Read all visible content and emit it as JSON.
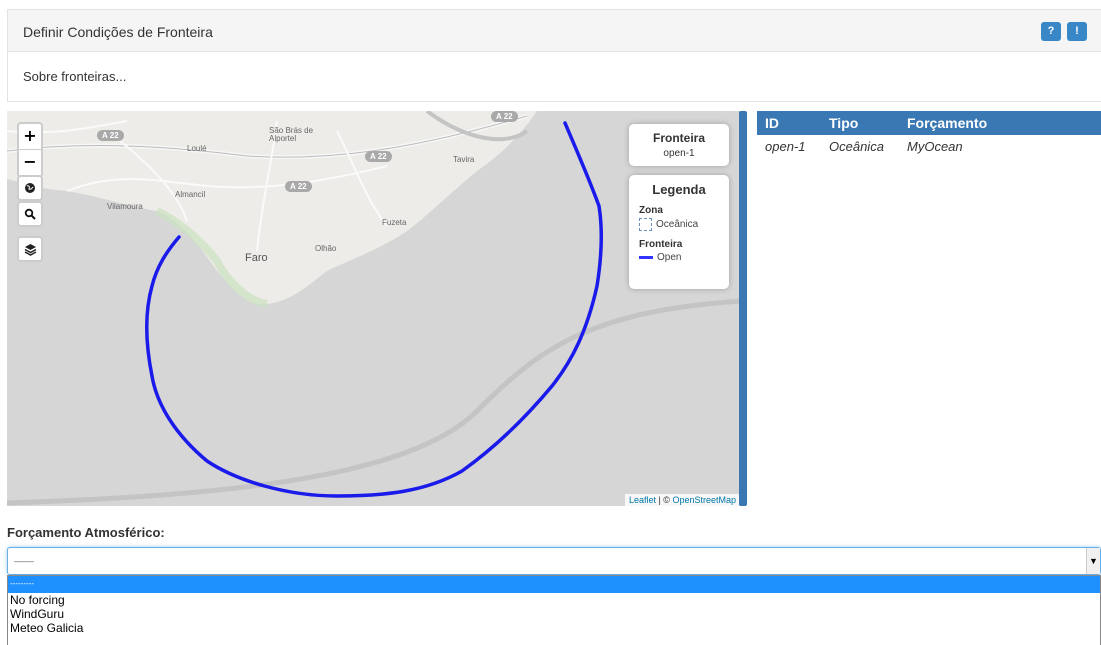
{
  "panel": {
    "title": "Definir Condições de Fronteira",
    "body": "Sobre fronteiras...",
    "help_icon": "question-icon",
    "info_icon": "info-icon",
    "help_label": "?",
    "info_label": "!"
  },
  "map": {
    "zoom_in": "+",
    "zoom_out": "−",
    "places": [
      "São Brás de Alportel",
      "Loulé",
      "Tavira",
      "Almancil",
      "Vilamoura",
      "Faro",
      "Olhão",
      "Fuzeta"
    ],
    "roads": [
      "A 22",
      "A 22",
      "A 22",
      "A 22"
    ],
    "info_title": "Fronteira",
    "info_value": "open-1",
    "legend_title": "Legenda",
    "legend_zone_header": "Zona",
    "legend_zone_item": "Oceânica",
    "legend_boundary_header": "Fronteira",
    "legend_boundary_item": "Open",
    "attribution_leaflet": "Leaflet",
    "attribution_sep": " | © ",
    "attribution_osm": "OpenStreetMap",
    "boundary_color": "#1a1aeb"
  },
  "table": {
    "headers": [
      "ID",
      "Tipo",
      "Forçamento"
    ],
    "rows": [
      [
        "open-1",
        "Oceânica",
        "MyOcean"
      ]
    ]
  },
  "forcing": {
    "label": "Forçamento Atmosférico:",
    "selected": "---------",
    "options": [
      "---------",
      "No forcing",
      "WindGuru",
      "Meteo Galicia"
    ]
  },
  "colors": {
    "accent": "#3a78b4",
    "select_highlight": "#1e90ff"
  }
}
